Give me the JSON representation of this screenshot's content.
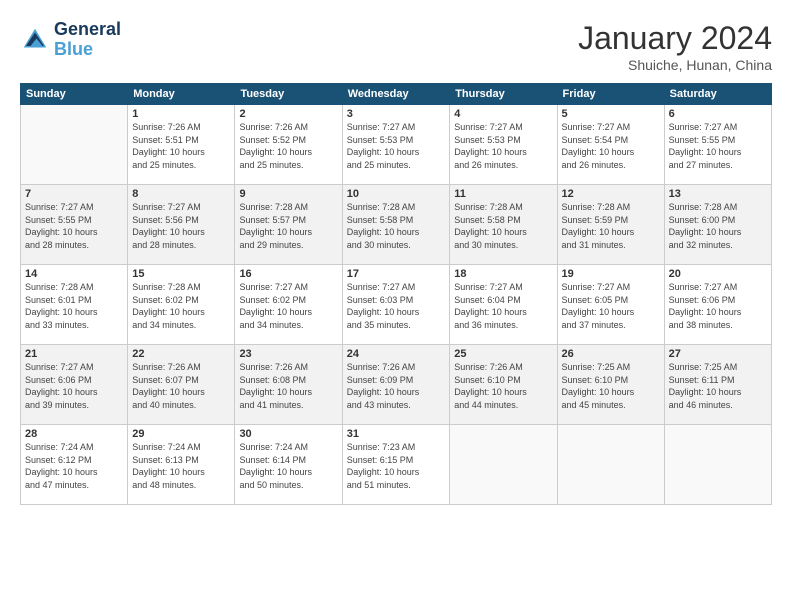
{
  "header": {
    "logo_line1": "General",
    "logo_line2": "Blue",
    "month": "January 2024",
    "location": "Shuiche, Hunan, China"
  },
  "days_of_week": [
    "Sunday",
    "Monday",
    "Tuesday",
    "Wednesday",
    "Thursday",
    "Friday",
    "Saturday"
  ],
  "weeks": [
    [
      {
        "day": "",
        "detail": ""
      },
      {
        "day": "1",
        "detail": "Sunrise: 7:26 AM\nSunset: 5:51 PM\nDaylight: 10 hours\nand 25 minutes."
      },
      {
        "day": "2",
        "detail": "Sunrise: 7:26 AM\nSunset: 5:52 PM\nDaylight: 10 hours\nand 25 minutes."
      },
      {
        "day": "3",
        "detail": "Sunrise: 7:27 AM\nSunset: 5:53 PM\nDaylight: 10 hours\nand 25 minutes."
      },
      {
        "day": "4",
        "detail": "Sunrise: 7:27 AM\nSunset: 5:53 PM\nDaylight: 10 hours\nand 26 minutes."
      },
      {
        "day": "5",
        "detail": "Sunrise: 7:27 AM\nSunset: 5:54 PM\nDaylight: 10 hours\nand 26 minutes."
      },
      {
        "day": "6",
        "detail": "Sunrise: 7:27 AM\nSunset: 5:55 PM\nDaylight: 10 hours\nand 27 minutes."
      }
    ],
    [
      {
        "day": "7",
        "detail": "Sunrise: 7:27 AM\nSunset: 5:55 PM\nDaylight: 10 hours\nand 28 minutes."
      },
      {
        "day": "8",
        "detail": "Sunrise: 7:27 AM\nSunset: 5:56 PM\nDaylight: 10 hours\nand 28 minutes."
      },
      {
        "day": "9",
        "detail": "Sunrise: 7:28 AM\nSunset: 5:57 PM\nDaylight: 10 hours\nand 29 minutes."
      },
      {
        "day": "10",
        "detail": "Sunrise: 7:28 AM\nSunset: 5:58 PM\nDaylight: 10 hours\nand 30 minutes."
      },
      {
        "day": "11",
        "detail": "Sunrise: 7:28 AM\nSunset: 5:58 PM\nDaylight: 10 hours\nand 30 minutes."
      },
      {
        "day": "12",
        "detail": "Sunrise: 7:28 AM\nSunset: 5:59 PM\nDaylight: 10 hours\nand 31 minutes."
      },
      {
        "day": "13",
        "detail": "Sunrise: 7:28 AM\nSunset: 6:00 PM\nDaylight: 10 hours\nand 32 minutes."
      }
    ],
    [
      {
        "day": "14",
        "detail": "Sunrise: 7:28 AM\nSunset: 6:01 PM\nDaylight: 10 hours\nand 33 minutes."
      },
      {
        "day": "15",
        "detail": "Sunrise: 7:28 AM\nSunset: 6:02 PM\nDaylight: 10 hours\nand 34 minutes."
      },
      {
        "day": "16",
        "detail": "Sunrise: 7:27 AM\nSunset: 6:02 PM\nDaylight: 10 hours\nand 34 minutes."
      },
      {
        "day": "17",
        "detail": "Sunrise: 7:27 AM\nSunset: 6:03 PM\nDaylight: 10 hours\nand 35 minutes."
      },
      {
        "day": "18",
        "detail": "Sunrise: 7:27 AM\nSunset: 6:04 PM\nDaylight: 10 hours\nand 36 minutes."
      },
      {
        "day": "19",
        "detail": "Sunrise: 7:27 AM\nSunset: 6:05 PM\nDaylight: 10 hours\nand 37 minutes."
      },
      {
        "day": "20",
        "detail": "Sunrise: 7:27 AM\nSunset: 6:06 PM\nDaylight: 10 hours\nand 38 minutes."
      }
    ],
    [
      {
        "day": "21",
        "detail": "Sunrise: 7:27 AM\nSunset: 6:06 PM\nDaylight: 10 hours\nand 39 minutes."
      },
      {
        "day": "22",
        "detail": "Sunrise: 7:26 AM\nSunset: 6:07 PM\nDaylight: 10 hours\nand 40 minutes."
      },
      {
        "day": "23",
        "detail": "Sunrise: 7:26 AM\nSunset: 6:08 PM\nDaylight: 10 hours\nand 41 minutes."
      },
      {
        "day": "24",
        "detail": "Sunrise: 7:26 AM\nSunset: 6:09 PM\nDaylight: 10 hours\nand 43 minutes."
      },
      {
        "day": "25",
        "detail": "Sunrise: 7:26 AM\nSunset: 6:10 PM\nDaylight: 10 hours\nand 44 minutes."
      },
      {
        "day": "26",
        "detail": "Sunrise: 7:25 AM\nSunset: 6:10 PM\nDaylight: 10 hours\nand 45 minutes."
      },
      {
        "day": "27",
        "detail": "Sunrise: 7:25 AM\nSunset: 6:11 PM\nDaylight: 10 hours\nand 46 minutes."
      }
    ],
    [
      {
        "day": "28",
        "detail": "Sunrise: 7:24 AM\nSunset: 6:12 PM\nDaylight: 10 hours\nand 47 minutes."
      },
      {
        "day": "29",
        "detail": "Sunrise: 7:24 AM\nSunset: 6:13 PM\nDaylight: 10 hours\nand 48 minutes."
      },
      {
        "day": "30",
        "detail": "Sunrise: 7:24 AM\nSunset: 6:14 PM\nDaylight: 10 hours\nand 50 minutes."
      },
      {
        "day": "31",
        "detail": "Sunrise: 7:23 AM\nSunset: 6:15 PM\nDaylight: 10 hours\nand 51 minutes."
      },
      {
        "day": "",
        "detail": ""
      },
      {
        "day": "",
        "detail": ""
      },
      {
        "day": "",
        "detail": ""
      }
    ]
  ]
}
